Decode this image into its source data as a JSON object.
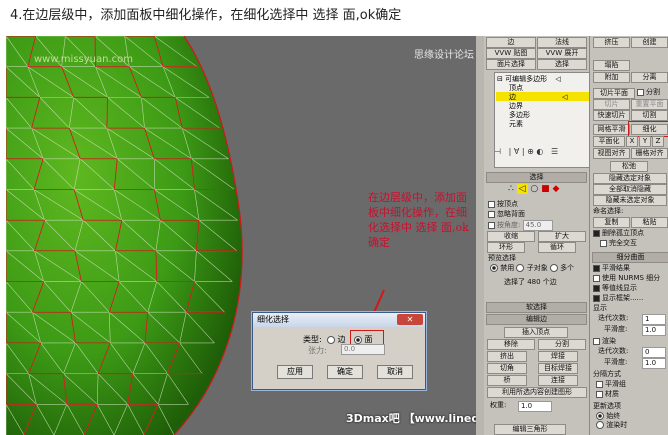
{
  "caption": "4.在边层级中，添加面板中细化操作，在细化选择中 选择 面,ok确定",
  "viewport": {
    "watermark_tl": "www.missyuan.com",
    "watermark_tr": "思缘设计论坛",
    "annotation": "在边层级中，添加面板中细化操作，在细化选择中 选择 面,ok确定",
    "footer": "3Dmax吧  【www.lineqq.com/tieba/1771】"
  },
  "dialog": {
    "title": "细化选择",
    "close": "✕",
    "type_label": "类型:",
    "opt_edge": "边",
    "opt_face": "面",
    "tension_label": "张力:",
    "tension_value": "0.0",
    "apply": "应用",
    "ok": "确定",
    "cancel": "取消"
  },
  "modifier_stack": {
    "root": "可编辑多边形",
    "items": [
      "顶点",
      "边",
      "边界",
      "多边形",
      "元素"
    ],
    "selected": "边"
  },
  "panel_top": {
    "b1": "边",
    "b2": "法线",
    "b3": "VVW 贴图",
    "b4": "VVW 展开",
    "b5": "面片选择",
    "b6": "选择",
    "b7": "点",
    "b8": "细化"
  },
  "selection": {
    "header": "选择",
    "by_vertex": "按顶点",
    "ignore_back": "忽略背面",
    "by_angle": "按角度:",
    "angle": "45.0",
    "shrink": "收缩",
    "grow": "扩大",
    "ring": "环形",
    "loop": "循环",
    "preview_header": "预览选择",
    "preview_off": "禁用",
    "preview_obj": "子对象",
    "preview_multi": "多个",
    "status": "选择了 480 个边"
  },
  "rollouts": {
    "soft": "软选择",
    "edit_edges": "编辑边",
    "insert_vertex": "插入顶点",
    "remove": "移除",
    "split": "分割",
    "extrude": "挤出",
    "weld": "焊接",
    "chamfer": "切角",
    "target_weld": "目标焊接",
    "bridge": "桥",
    "connect": "连接",
    "create_shape": "利用所选内容创建图形",
    "weight_label": "权重:",
    "weight": "1.0",
    "edit_tris": "编辑三角形"
  },
  "col3": {
    "slice_plane": "切片平面",
    "split": "分割",
    "slice": "切片",
    "reset_plane": "重置平面",
    "quick_slice": "快速切片",
    "cut": "切割",
    "msmooth": "网格平滑",
    "tessellate": "细化",
    "planarize": "平面化",
    "x": "X",
    "y": "Y",
    "z": "Z",
    "view_align": "视图对齐",
    "grid_align": "栅格对齐",
    "relax": "松弛",
    "hide_sel": "隐藏选定对象",
    "unhide_all": "全部取消隐藏",
    "hide_unsel": "隐藏未选定对象",
    "named_sel": "命名选择:",
    "copy": "复制",
    "paste": "粘贴",
    "delete_iso": "删除孤立顶点",
    "full_interact": "完全交互",
    "subdiv_header": "细分曲面",
    "smooth_result": "平滑结果",
    "use_nurms": "使用 NURMS 细分",
    "isoline": "等值线显示",
    "show_cage": "显示框架......",
    "display": "显示",
    "iterations": "迭代次数:",
    "iter_val": "1",
    "smoothness": "平滑度:",
    "smooth_val": "1.0",
    "render": "渲染",
    "r_iter": "迭代次数:",
    "r_iter_val": "0",
    "r_smooth": "平滑度:",
    "r_smooth_val": "1.0",
    "sep_by": "分隔方式",
    "smooth_groups": "平滑组",
    "materials": "材质",
    "update_opts": "更新选项",
    "always": "始终",
    "when_render": "渲染时",
    "manually": "手动",
    "update": "更新",
    "col3_top1": "挤压",
    "col3_top2": "创建",
    "col3_top3": "塌陷",
    "col3_top4": "附加",
    "col3_top5": "分离",
    "col3_top6": "选择",
    "col3_top7": "平面化"
  },
  "colors": {
    "mesh_green": "#3c9a15",
    "edge_red": "#d01818",
    "stack_highlight": "#f5e200",
    "annotation_red": "#c8102e"
  }
}
